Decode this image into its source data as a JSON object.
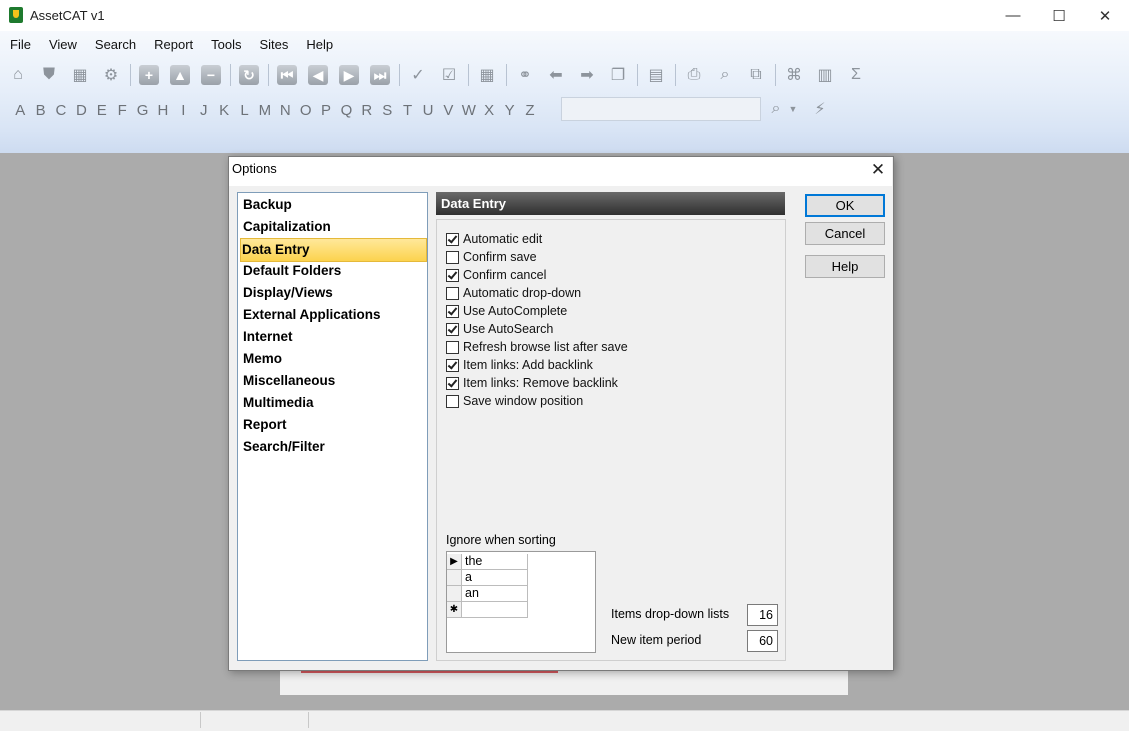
{
  "window": {
    "title": "AssetCAT v1",
    "controls": {
      "minimize": "—",
      "maximize": "☐",
      "close": "✕"
    }
  },
  "menu": [
    "File",
    "View",
    "Search",
    "Report",
    "Tools",
    "Sites",
    "Help"
  ],
  "alphabet": [
    "A",
    "B",
    "C",
    "D",
    "E",
    "F",
    "G",
    "H",
    "I",
    "J",
    "K",
    "L",
    "M",
    "N",
    "O",
    "P",
    "Q",
    "R",
    "S",
    "T",
    "U",
    "V",
    "W",
    "X",
    "Y",
    "Z"
  ],
  "dialog": {
    "title": "Options",
    "close": "✕",
    "categories": [
      "Backup",
      "Capitalization",
      "Data Entry",
      "Default Folders",
      "Display/Views",
      "External Applications",
      "Internet",
      "Memo",
      "Miscellaneous",
      "Multimedia",
      "Report",
      "Search/Filter"
    ],
    "selected_category": "Data Entry",
    "panel_title": "Data Entry",
    "options": [
      {
        "label": "Automatic edit",
        "checked": true
      },
      {
        "label": "Confirm save",
        "checked": false
      },
      {
        "label": "Confirm cancel",
        "checked": true
      },
      {
        "label": "Automatic drop-down",
        "checked": false
      },
      {
        "label": "Use AutoComplete",
        "checked": true
      },
      {
        "label": "Use AutoSearch",
        "checked": true
      },
      {
        "label": "Refresh browse list after save",
        "checked": false
      },
      {
        "label": "Item links: Add backlink",
        "checked": true
      },
      {
        "label": "Item links: Remove backlink",
        "checked": true
      },
      {
        "label": "Save window position",
        "checked": false
      }
    ],
    "ignore_label": "Ignore when sorting",
    "ignore_words": [
      "the",
      "a",
      "an",
      ""
    ],
    "row_markers": [
      "▶",
      "",
      "",
      "✱"
    ],
    "items_dropdown_label": "Items drop-down lists",
    "items_dropdown_value": "16",
    "new_item_label": "New item period",
    "new_item_value": "60",
    "buttons": {
      "ok": "OK",
      "cancel": "Cancel",
      "help": "Help"
    }
  },
  "colors": {
    "accent": "#0078d7",
    "selected_category": "#fcd34e",
    "header": "#2f2f2f"
  }
}
